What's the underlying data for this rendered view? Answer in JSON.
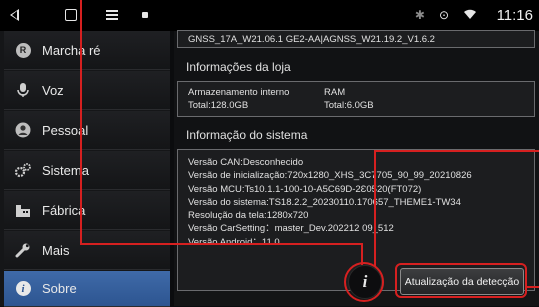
{
  "status_bar": {
    "time": "11:16",
    "icons": [
      "back-icon",
      "home-icon",
      "menu-icon",
      "notification-icon",
      "bluetooth-icon",
      "location-icon",
      "wifi-icon"
    ]
  },
  "sidebar": {
    "items": [
      {
        "label": "Marcha ré",
        "icon": "r-circle-icon",
        "icon_text": "R"
      },
      {
        "label": "Voz",
        "icon": "microphone-icon"
      },
      {
        "label": "Pessoal",
        "icon": "person-icon"
      },
      {
        "label": "Sistema",
        "icon": "gears-icon"
      },
      {
        "label": "Fábrica",
        "icon": "factory-icon"
      },
      {
        "label": "Mais",
        "icon": "wrench-icon"
      },
      {
        "label": "Sobre",
        "icon": "info-circle-icon",
        "active": true
      }
    ]
  },
  "main": {
    "gnss_line": "GNSS_17A_W21.06.1 GE2-AA|AGNSS_W21.19.2_V1.6.2",
    "store_title": "Informações da loja",
    "storage": {
      "internal_label": "Armazenamento interno",
      "internal_total": "Total:128.0GB",
      "ram_label": "RAM",
      "ram_total": "Total:6.0GB"
    },
    "system_title": "Informação do sistema",
    "system_lines": [
      "Versão CAN:Desconhecido",
      "Versão de inicialização:720x1280_XHS_3C7705_90_99_20210826",
      "Versão MCU:Ts10.1.1-100-10-A5C69D-2Ɛ0520(FT072)",
      "Versão do sistema:TS18.2.2_20230110.170657_THEME1-TW34",
      "Resolução da tela:1280x720",
      "Versão CarSetting：master_Dev.202212 09_512",
      "Versão Android：11.0"
    ],
    "info_button_glyph": "i",
    "update_button_label": "Atualização da detecção"
  },
  "colors": {
    "accent": "#2d5591",
    "annotation": "#d62020"
  }
}
